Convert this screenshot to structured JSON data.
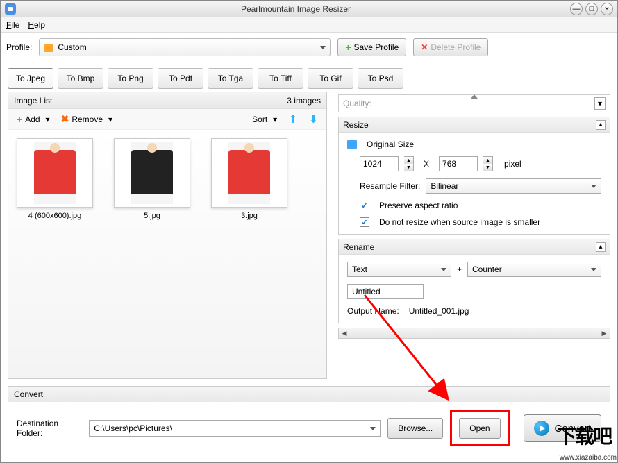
{
  "window": {
    "title": "Pearlmountain Image Resizer"
  },
  "menu": {
    "file": "File",
    "help": "Help"
  },
  "profile": {
    "label": "Profile:",
    "value": "Custom",
    "save": "Save Profile",
    "delete": "Delete Profile"
  },
  "tabs": [
    "To Jpeg",
    "To Bmp",
    "To Png",
    "To Pdf",
    "To Tga",
    "To Tiff",
    "To Gif",
    "To Psd"
  ],
  "imagelist": {
    "title": "Image List",
    "count": "3 images",
    "add": "Add",
    "remove": "Remove",
    "sort": "Sort",
    "items": [
      {
        "label": "4 (600x600).jpg",
        "style": "red"
      },
      {
        "label": "5.jpg",
        "style": "dark"
      },
      {
        "label": "3.jpg",
        "style": "red"
      }
    ]
  },
  "quality": {
    "label": "Quality:"
  },
  "resize": {
    "title": "Resize",
    "original": "Original Size",
    "width": "1024",
    "x": "X",
    "height": "768",
    "unit": "pixel",
    "resample_label": "Resample Filter:",
    "resample_value": "Bilinear",
    "preserve": "Preserve aspect ratio",
    "noresize": "Do not resize when source image is smaller"
  },
  "rename": {
    "title": "Rename",
    "mode1": "Text",
    "plus": "+",
    "mode2": "Counter",
    "text_value": "Untitled",
    "output_label": "Output Name:",
    "output_value": "Untitled_001.jpg"
  },
  "convert": {
    "title": "Convert",
    "dest_label": "Destination Folder:",
    "dest_value": "C:\\Users\\pc\\Pictures\\",
    "browse": "Browse...",
    "open": "Open",
    "convert": "Convert"
  },
  "watermark": {
    "big": "下载吧",
    "small": "www.xiazaiba.com"
  }
}
